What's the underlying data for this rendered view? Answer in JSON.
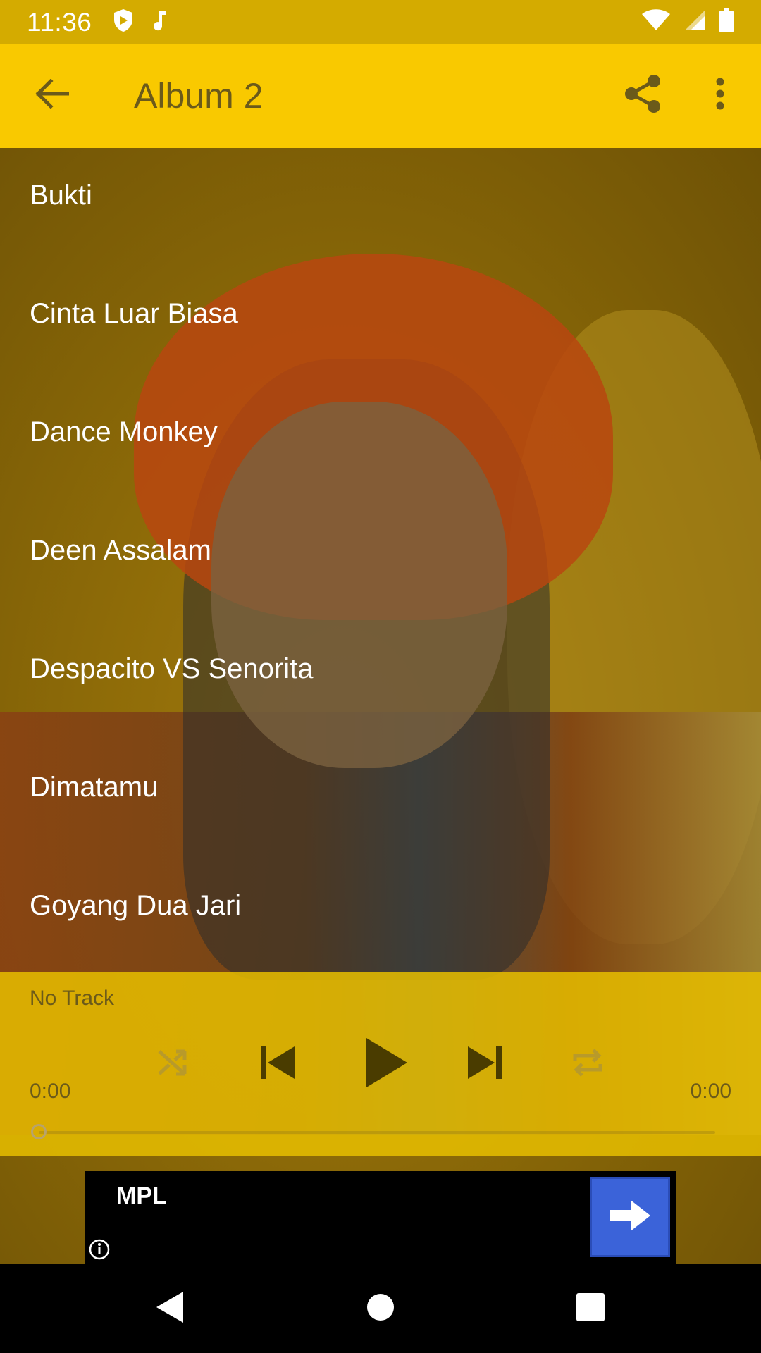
{
  "status_bar": {
    "time": "11:36",
    "icons_left": [
      "shield-icon",
      "music-note-icon"
    ],
    "icons_right": [
      "wifi-icon",
      "cellular-signal-icon",
      "battery-icon"
    ]
  },
  "app_bar": {
    "title": "Album 2",
    "back_icon": "arrow-back-icon",
    "share_icon": "share-icon",
    "more_icon": "more-vertical-icon",
    "background_color": "#f9c900"
  },
  "tracks": [
    {
      "title": "Bukti"
    },
    {
      "title": "Cinta Luar Biasa"
    },
    {
      "title": "Dance Monkey"
    },
    {
      "title": "Deen Assalam"
    },
    {
      "title": "Despacito VS Senorita"
    },
    {
      "title": "Dimatamu"
    },
    {
      "title": "Goyang Dua Jari"
    }
  ],
  "player": {
    "now_playing": "No Track",
    "current_time": "0:00",
    "total_time": "0:00",
    "progress": 0,
    "controls": [
      "shuffle-icon",
      "skip-previous-icon",
      "play-icon",
      "skip-next-icon",
      "repeat-icon"
    ]
  },
  "ad": {
    "title": "MPL",
    "cta_icon": "arrow-right-icon",
    "info_icon": "info-icon"
  },
  "nav_bar": {
    "icons": [
      "back-triangle-icon",
      "home-circle-icon",
      "recents-square-icon"
    ]
  }
}
